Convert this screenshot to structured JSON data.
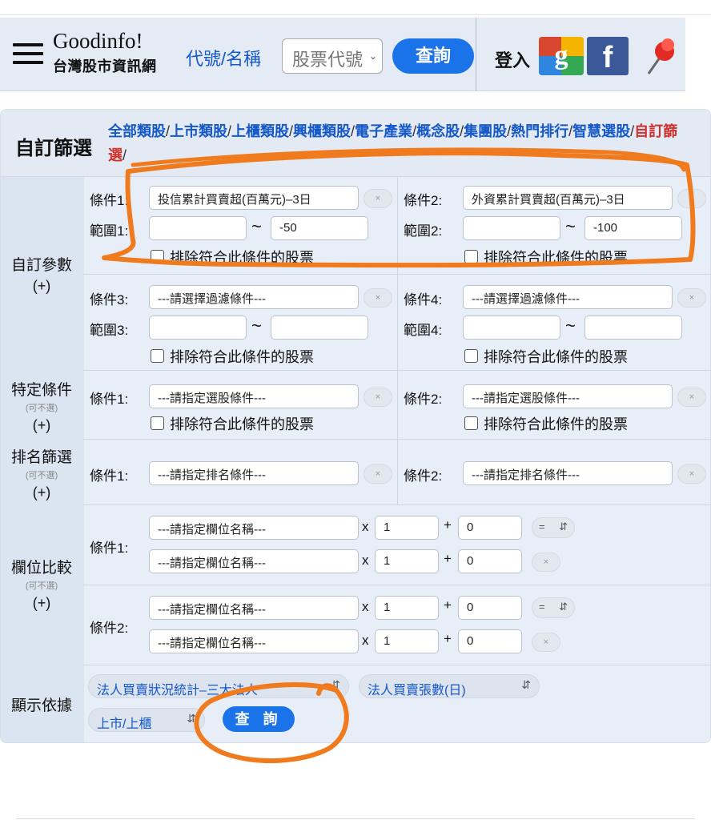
{
  "header": {
    "brand_en": "Goodinfo!",
    "brand_zh": "台灣股市資訊網",
    "code_label": "代號/名稱",
    "code_placeholder": "股票代號",
    "query_label": "查詢",
    "login_label": "登入"
  },
  "panel": {
    "title": "自訂篩選",
    "categories": [
      "全部類股",
      "上市類股",
      "上櫃類股",
      "興櫃類股",
      "電子產業",
      "概念股",
      "集團股",
      "熱門排行",
      "智慧選股",
      "自訂篩選"
    ],
    "active_category": "自訂篩選"
  },
  "sections": {
    "custom_params": {
      "label": "自訂參數",
      "plus": "(+)"
    },
    "specific": {
      "label": "特定條件",
      "sub": "(可不選)",
      "plus": "(+)"
    },
    "rank": {
      "label": "排名篩選",
      "sub": "(可不選)",
      "plus": "(+)"
    },
    "field_compare": {
      "label": "欄位比較",
      "sub": "(可不選)",
      "plus": "(+)"
    },
    "display": {
      "label": "顯示依據"
    }
  },
  "custom": {
    "cond1": {
      "label": "條件1:",
      "value": "投信累計買賣超(百萬元)–3日",
      "range_label": "範圍1:",
      "min": "",
      "max": "-50",
      "exclude": "排除符合此條件的股票"
    },
    "cond2": {
      "label": "條件2:",
      "value": "外資累計買賣超(百萬元)–3日",
      "range_label": "範圍2:",
      "min": "",
      "max": "-100",
      "exclude": "排除符合此條件的股票"
    },
    "cond3": {
      "label": "條件3:",
      "value": "---請選擇過濾條件---",
      "range_label": "範圍3:",
      "min": "",
      "max": "",
      "exclude": "排除符合此條件的股票"
    },
    "cond4": {
      "label": "條件4:",
      "value": "---請選擇過濾條件---",
      "range_label": "範圍4:",
      "min": "",
      "max": "",
      "exclude": "排除符合此條件的股票"
    },
    "tilde": "~",
    "clear": "×"
  },
  "specific": {
    "cond1": {
      "label": "條件1:",
      "value": "---請指定選股條件---",
      "exclude": "排除符合此條件的股票"
    },
    "cond2": {
      "label": "條件2:",
      "value": "---請指定選股條件---",
      "exclude": "排除符合此條件的股票"
    }
  },
  "rank": {
    "cond1": {
      "label": "條件1:",
      "value": "---請指定排名條件---"
    },
    "cond2": {
      "label": "條件2:",
      "value": "---請指定排名條件---"
    }
  },
  "compare": {
    "times": "x",
    "plus": "+",
    "eq": "=",
    "cond1": {
      "label": "條件1:",
      "field_a": "---請指定欄位名稱---",
      "mult_a": "1",
      "add_a": "0",
      "field_b": "---請指定欄位名稱---",
      "mult_b": "1",
      "add_b": "0"
    },
    "cond2": {
      "label": "條件2:",
      "field_a": "---請指定欄位名稱---",
      "mult_a": "1",
      "add_a": "0",
      "field_b": "---請指定欄位名稱---",
      "mult_b": "1",
      "add_b": "0"
    }
  },
  "display": {
    "sheet": "法人買賣狀況統計–三大法人",
    "detail": "法人買賣張數(日)",
    "market": "上市/上櫃",
    "query_label": "查 詢"
  },
  "colors": {
    "accent": "#1a73e8",
    "link": "#1558c8",
    "active": "#d0312d",
    "annotation": "#f07b1e"
  }
}
